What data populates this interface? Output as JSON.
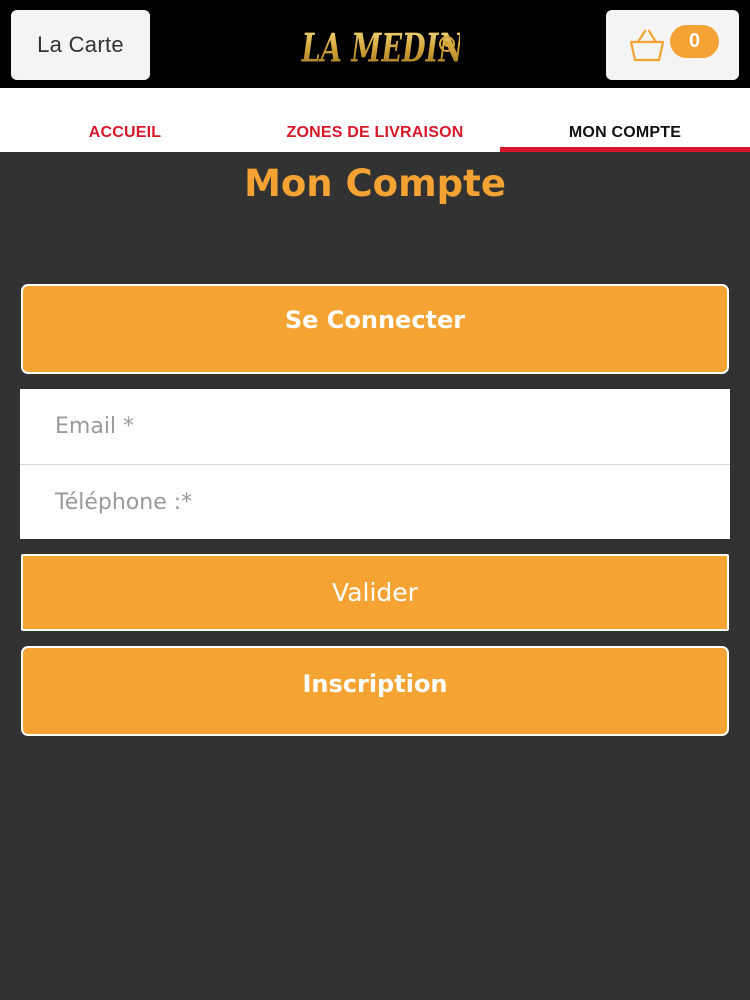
{
  "header": {
    "menu_label": "La Carte",
    "logo_text": "LA MEDINA",
    "cart_count": "0"
  },
  "tabs": [
    {
      "label": "ACCUEIL"
    },
    {
      "label": "ZONES DE LIVRAISON"
    },
    {
      "label": "MON COMPTE",
      "active": true
    }
  ],
  "page": {
    "title": "Mon Compte",
    "connect_label": "Se Connecter",
    "email_placeholder": "Email *",
    "phone_placeholder": "Téléphone :*",
    "validate_label": "Valider",
    "signup_label": "Inscription"
  },
  "colors": {
    "accent": "#f4a233",
    "tab_red": "#d7182a",
    "background": "#323232"
  },
  "icons": [
    "shopping-bag-icon"
  ]
}
